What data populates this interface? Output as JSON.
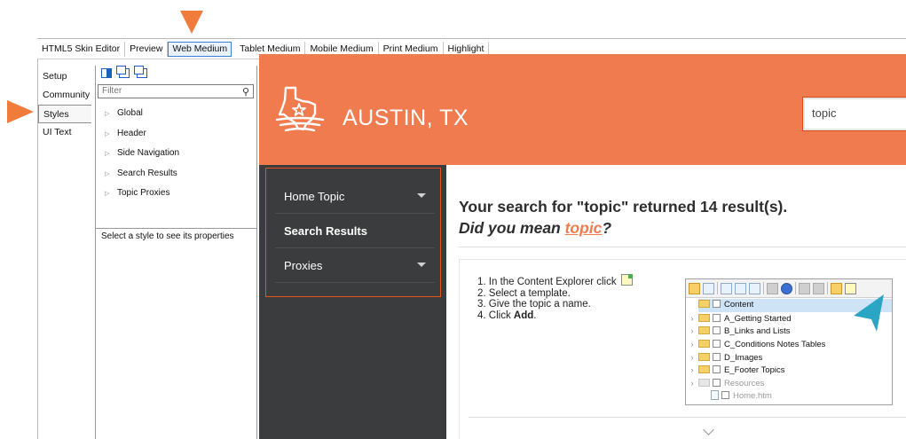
{
  "tabs": [
    "HTML5 Skin Editor",
    "Preview",
    "Web Medium",
    "Tablet Medium",
    "Mobile Medium",
    "Print Medium",
    "Highlight"
  ],
  "active_tab": "Web Medium",
  "left_nav": [
    "Setup",
    "Community",
    "Styles",
    "UI Text"
  ],
  "active_left_nav": "Styles",
  "styles_panel": {
    "filter_placeholder": "Filter",
    "tree": [
      "Global",
      "Header",
      "Side Navigation",
      "Search Results",
      "Topic Proxies"
    ],
    "hint": "Select a style to see its properties"
  },
  "preview": {
    "site_title": "AUSTIN, TX",
    "search_value": "topic",
    "nav_items": [
      {
        "label": "Home Topic",
        "has_submenu": true
      },
      {
        "label": "Search Results",
        "has_submenu": false
      },
      {
        "label": "Proxies",
        "has_submenu": true
      }
    ],
    "results_heading": "Your search for \"topic\" returned 14 result(s).",
    "did_you_mean_prefix": "Did you mean ",
    "did_you_mean_suggestion": "topic",
    "did_you_mean_suffix": "?",
    "steps": {
      "s1": "1. In the Content Explorer click",
      "s2": "2. Select a template.",
      "s3": "3. Give the topic a name.",
      "s4_prefix": "4. Click ",
      "s4_bold": "Add",
      "s4_suffix": "."
    },
    "explorer": {
      "root": "Content",
      "items": [
        "A_Getting Started",
        "B_Links and Lists",
        "C_Conditions Notes Tables",
        "D_Images",
        "E_Footer Topics",
        "Resources"
      ],
      "file": "Home.htm"
    }
  },
  "colors": {
    "accent_orange": "#f07b4f",
    "callout_orange": "#f07b3a",
    "highlight_red": "#e5521c",
    "sidebar_dark": "#3a3c3d",
    "callout_teal": "#2aa6c4"
  }
}
